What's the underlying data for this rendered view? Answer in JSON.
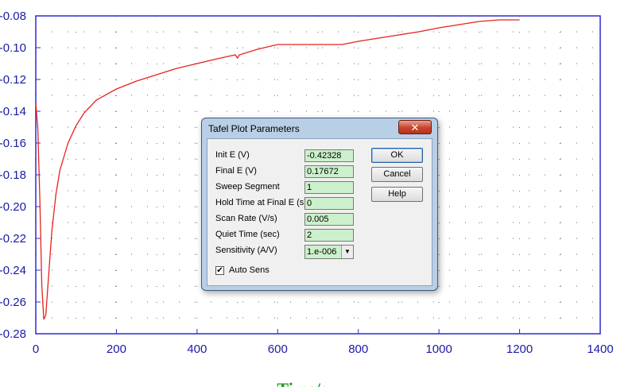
{
  "chart_data": {
    "type": "line",
    "xlabel": "Time/s",
    "ylabel": "",
    "xlim": [
      0,
      1400
    ],
    "ylim": [
      -0.28,
      -0.08
    ],
    "x_ticks": [
      "0",
      "200",
      "400",
      "600",
      "800",
      "1000",
      "1200",
      "1400"
    ],
    "y_ticks": [
      "-0.08",
      "-0.10",
      "-0.12",
      "-0.14",
      "-0.16",
      "-0.18",
      "-0.20",
      "-0.22",
      "-0.24",
      "-0.26",
      "-0.28"
    ],
    "grid": "dotted",
    "series": [
      {
        "color": "#e8211e",
        "x": [
          0,
          5,
          10,
          15,
          20,
          25,
          30,
          40,
          50,
          60,
          80,
          100,
          120,
          150,
          200,
          250,
          300,
          350,
          400,
          450,
          495,
          500,
          505,
          550,
          600,
          650,
          700,
          760,
          800,
          850,
          900,
          950,
          1000,
          1050,
          1100,
          1150,
          1200
        ],
        "y": [
          -0.135,
          -0.15,
          -0.195,
          -0.25,
          -0.271,
          -0.268,
          -0.25,
          -0.215,
          -0.192,
          -0.177,
          -0.16,
          -0.149,
          -0.141,
          -0.133,
          -0.126,
          -0.121,
          -0.117,
          -0.113,
          -0.11,
          -0.107,
          -0.1045,
          -0.1065,
          -0.1045,
          -0.101,
          -0.098,
          -0.098,
          -0.098,
          -0.098,
          -0.096,
          -0.094,
          -0.092,
          -0.09,
          -0.0875,
          -0.0855,
          -0.0835,
          -0.0825,
          -0.0825
        ]
      }
    ]
  },
  "dialog": {
    "title": "Tafel Plot Parameters",
    "close_label": "✕",
    "fields": [
      {
        "label": "Init E (V)",
        "value": "-0.42328"
      },
      {
        "label": "Final E (V)",
        "value": "0.17672"
      },
      {
        "label": "Sweep Segment",
        "value": "1"
      },
      {
        "label": "Hold Time at Final E (s)",
        "value": "0"
      },
      {
        "label": "Scan Rate (V/s)",
        "value": "0.005"
      },
      {
        "label": "Quiet Time (sec)",
        "value": "2"
      }
    ],
    "sensitivity": {
      "label": "Sensitivity (A/V)",
      "value": "1.e-006"
    },
    "auto_sens": {
      "label": "Auto Sens",
      "checked": true
    },
    "buttons": {
      "ok": "OK",
      "cancel": "Cancel",
      "help": "Help"
    }
  }
}
